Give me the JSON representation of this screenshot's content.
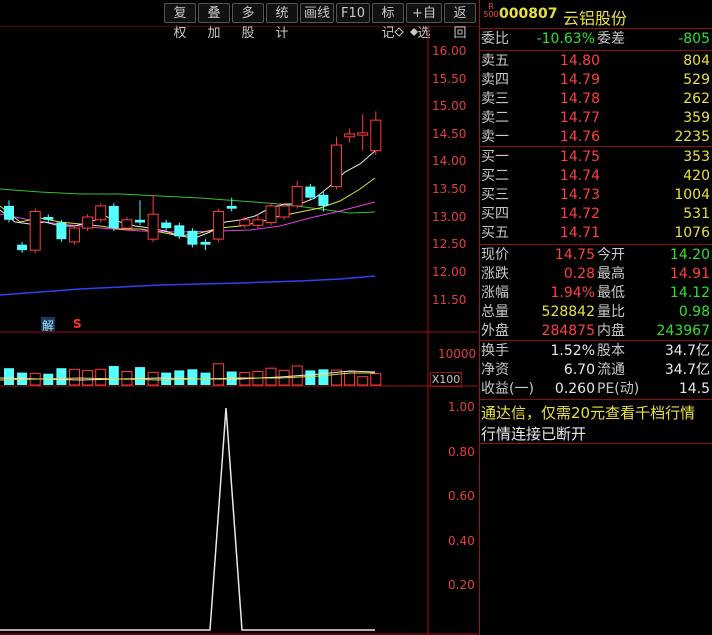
{
  "toolbar": {
    "buttons": [
      "复权",
      "叠加",
      "多股",
      "统计",
      "画线",
      "F10",
      "标记",
      "+自选",
      "返回"
    ]
  },
  "chart": {
    "price_axis": [
      "16.00",
      "15.50",
      "15.00",
      "14.50",
      "14.00",
      "13.50",
      "13.00",
      "12.50",
      "12.00",
      "11.50"
    ],
    "volume_axis": [
      "10000"
    ],
    "volume_unit": "X100",
    "indicator_axis": [
      "1.00",
      "0.80",
      "0.60",
      "0.40",
      "0.20"
    ],
    "markers": {
      "jie": "解",
      "s": "S"
    },
    "candles": [
      {
        "o": 13.2,
        "c": 12.95,
        "h": 13.3,
        "l": 12.9
      },
      {
        "o": 12.5,
        "c": 12.4,
        "h": 12.55,
        "l": 12.35
      },
      {
        "o": 12.4,
        "c": 13.1,
        "h": 13.15,
        "l": 12.35
      },
      {
        "o": 13.0,
        "c": 12.95,
        "h": 13.05,
        "l": 12.9
      },
      {
        "o": 12.9,
        "c": 12.6,
        "h": 12.95,
        "l": 12.55
      },
      {
        "o": 12.55,
        "c": 12.8,
        "h": 12.85,
        "l": 12.5
      },
      {
        "o": 12.8,
        "c": 13.0,
        "h": 13.05,
        "l": 12.75
      },
      {
        "o": 12.95,
        "c": 13.2,
        "h": 13.25,
        "l": 12.9
      },
      {
        "o": 13.2,
        "c": 12.8,
        "h": 13.25,
        "l": 12.75
      },
      {
        "o": 12.8,
        "c": 12.95,
        "h": 13.0,
        "l": 12.75
      },
      {
        "o": 12.95,
        "c": 12.9,
        "h": 13.3,
        "l": 12.85
      },
      {
        "o": 12.6,
        "c": 13.05,
        "h": 13.4,
        "l": 12.55
      },
      {
        "o": 12.9,
        "c": 12.8,
        "h": 12.95,
        "l": 12.75
      },
      {
        "o": 12.85,
        "c": 12.65,
        "h": 12.9,
        "l": 12.6
      },
      {
        "o": 12.75,
        "c": 12.5,
        "h": 12.8,
        "l": 12.45
      },
      {
        "o": 12.55,
        "c": 12.5,
        "h": 12.6,
        "l": 12.4
      },
      {
        "o": 12.6,
        "c": 13.1,
        "h": 13.15,
        "l": 12.55
      },
      {
        "o": 13.2,
        "c": 13.15,
        "h": 13.35,
        "l": 13.1
      },
      {
        "o": 12.85,
        "c": 12.95,
        "h": 13.0,
        "l": 12.8
      },
      {
        "o": 12.85,
        "c": 12.95,
        "h": 13.05,
        "l": 12.8
      },
      {
        "o": 12.9,
        "c": 13.2,
        "h": 13.25,
        "l": 12.85
      },
      {
        "o": 13.0,
        "c": 13.2,
        "h": 13.25,
        "l": 12.95
      },
      {
        "o": 13.2,
        "c": 13.55,
        "h": 13.65,
        "l": 13.15
      },
      {
        "o": 13.55,
        "c": 13.35,
        "h": 13.6,
        "l": 13.3
      },
      {
        "o": 13.4,
        "c": 13.2,
        "h": 13.45,
        "l": 13.1
      },
      {
        "o": 13.55,
        "c": 14.3,
        "h": 14.45,
        "l": 13.5
      },
      {
        "o": 14.45,
        "c": 14.5,
        "h": 14.6,
        "l": 14.35
      },
      {
        "o": 14.48,
        "c": 14.52,
        "h": 14.85,
        "l": 14.2
      },
      {
        "o": 14.2,
        "c": 14.75,
        "h": 14.91,
        "l": 14.12
      }
    ]
  },
  "quote": {
    "badge_top": "R",
    "badge_bottom": "500",
    "code": "000807",
    "name": "云铝股份",
    "weibi_label": "委比",
    "weibi": "-10.63%",
    "weicha_label": "委差",
    "weicha": "-805",
    "asks": [
      {
        "label": "卖五",
        "price": "14.80",
        "vol": "804"
      },
      {
        "label": "卖四",
        "price": "14.79",
        "vol": "529"
      },
      {
        "label": "卖三",
        "price": "14.78",
        "vol": "262"
      },
      {
        "label": "卖二",
        "price": "14.77",
        "vol": "359"
      },
      {
        "label": "卖一",
        "price": "14.76",
        "vol": "2235"
      }
    ],
    "bids": [
      {
        "label": "买一",
        "price": "14.75",
        "vol": "353"
      },
      {
        "label": "买二",
        "price": "14.74",
        "vol": "420"
      },
      {
        "label": "买三",
        "price": "14.73",
        "vol": "1004"
      },
      {
        "label": "买四",
        "price": "14.72",
        "vol": "531"
      },
      {
        "label": "买五",
        "price": "14.71",
        "vol": "1076"
      }
    ],
    "stats1": [
      {
        "l1": "现价",
        "v1": "14.75",
        "c1": "red",
        "l2": "今开",
        "v2": "14.20",
        "c2": "green"
      },
      {
        "l1": "涨跌",
        "v1": "0.28",
        "c1": "red",
        "l2": "最高",
        "v2": "14.91",
        "c2": "red"
      },
      {
        "l1": "涨幅",
        "v1": "1.94%",
        "c1": "red",
        "l2": "最低",
        "v2": "14.12",
        "c2": "green"
      },
      {
        "l1": "总量",
        "v1": "528842",
        "c1": "yellow",
        "l2": "量比",
        "v2": "0.98",
        "c2": "green"
      },
      {
        "l1": "外盘",
        "v1": "284875",
        "c1": "red",
        "l2": "内盘",
        "v2": "243967",
        "c2": "green"
      }
    ],
    "stats2": [
      {
        "l1": "换手",
        "v1": "1.52%",
        "l2": "股本",
        "v2": "34.7亿"
      },
      {
        "l1": "净资",
        "v1": "6.70",
        "l2": "流通",
        "v2": "34.7亿"
      },
      {
        "l1": "收益(一)",
        "v1": "0.260",
        "l2": "PE(动)",
        "v2": "14.5"
      }
    ],
    "promo": "通达信，仅需20元查看千档行情",
    "status": "行情连接已断开"
  }
}
